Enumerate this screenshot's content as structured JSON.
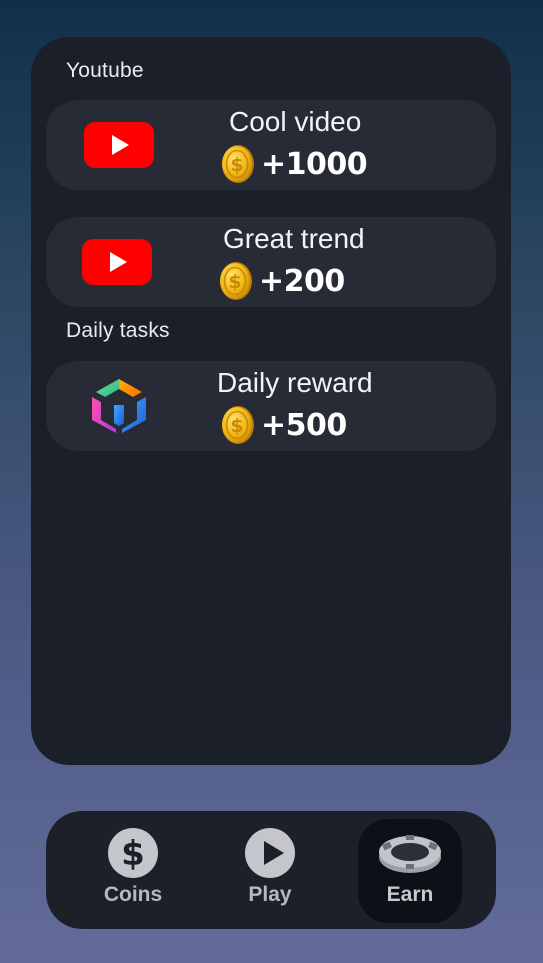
{
  "sections": {
    "youtube": "Youtube",
    "daily": "Daily tasks"
  },
  "tasks": [
    {
      "title": "Cool video",
      "reward": "+1000",
      "icon": "youtube-icon"
    },
    {
      "title": "Great trend",
      "reward": "+200",
      "icon": "youtube-icon"
    },
    {
      "title": "Daily reward",
      "reward": "+500",
      "icon": "cube-icon"
    }
  ],
  "nav": [
    {
      "label": "Coins",
      "icon": "dollar-icon",
      "active": false
    },
    {
      "label": "Play",
      "icon": "play-icon",
      "active": false
    },
    {
      "label": "Earn",
      "icon": "chip-icon",
      "active": true
    }
  ],
  "colors": {
    "youtube_red": "#ff0000",
    "coin_gold": "#f5c518",
    "panel_bg": "#1a1f29",
    "card_bg": "#272b35"
  }
}
